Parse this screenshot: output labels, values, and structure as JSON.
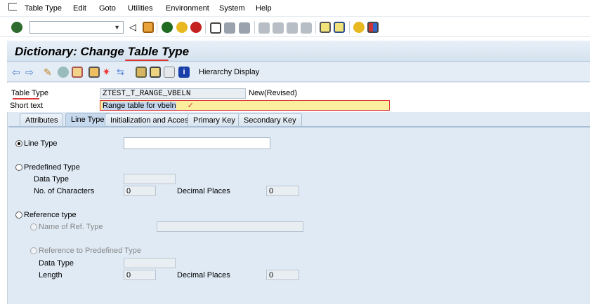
{
  "menu": {
    "items": [
      "Table Type",
      "Edit",
      "Goto",
      "Utilities",
      "Environment",
      "System",
      "Help"
    ]
  },
  "toolbar": {
    "command_field": ""
  },
  "screen": {
    "title": "Dictionary: Change Table Type",
    "hierarchy_display": "Hierarchy Display"
  },
  "header": {
    "table_type_label": "Table Type",
    "table_type_value": "ZTEST_T_RANGE_VBELN",
    "status": "New(Revised)",
    "short_text_label": "Short text",
    "short_text_value": "Range table for vbeln"
  },
  "tabs": [
    "Attributes",
    "Line Type",
    "Initialization and Access",
    "Primary Key",
    "Secondary Key"
  ],
  "active_tab": "Line Type",
  "line_type": {
    "line_type_label": "Line Type",
    "line_type_value": "",
    "predefined_label": "Predefined Type",
    "data_type_label": "Data Type",
    "data_type_value": "",
    "no_chars_label": "No. of Characters",
    "no_chars_value": "0",
    "decimal_label": "Decimal Places",
    "decimal_value": "0",
    "reference_label": "Reference type",
    "ref_name_label": "Name of Ref. Type",
    "ref_name_value": "",
    "ref_predef_label": "Reference to Predefined Type",
    "ref_data_type_label": "Data Type",
    "ref_data_type_value": "",
    "length_label": "Length",
    "length_value": "0",
    "ref_decimal_label": "Decimal Places",
    "ref_decimal_value": "0"
  }
}
